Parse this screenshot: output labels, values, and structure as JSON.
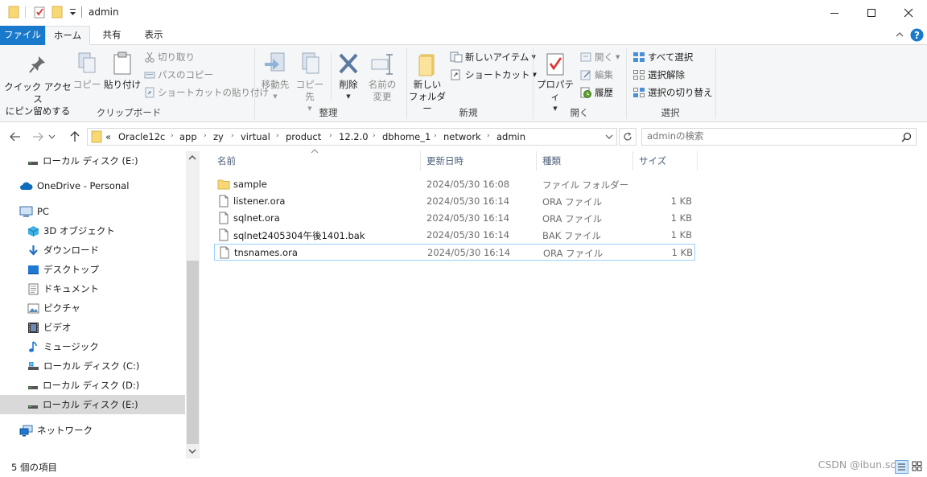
{
  "window": {
    "title": "admin",
    "minimize_glyph": "—",
    "maximize_glyph": "☐",
    "close_glyph": "✕"
  },
  "ribbon_tabs": [
    {
      "label": "ファイル"
    },
    {
      "label": "ホーム"
    },
    {
      "label": "共有"
    },
    {
      "label": "表示"
    }
  ],
  "ribbon": {
    "clipboard": {
      "pin_quick_access_line1": "クイック アクセス",
      "pin_quick_access_line2": "にピン留めする",
      "copy": "コピー",
      "paste": "貼り付け",
      "cut": "切り取り",
      "copy_path": "パスのコピー",
      "paste_shortcut": "ショートカットの貼り付け",
      "group_label": "クリップボード"
    },
    "organize": {
      "move_to": "移動先",
      "copy_to": "コピー先",
      "delete": "削除",
      "rename_line1": "名前の",
      "rename_line2": "変更",
      "group_label": "整理"
    },
    "new": {
      "new_folder_line1": "新しい",
      "new_folder_line2": "フォルダー",
      "new_item": "新しいアイテム",
      "shortcut": "ショートカット",
      "group_label": "新規"
    },
    "open": {
      "properties": "プロパティ",
      "open": "開く",
      "edit": "編集",
      "history": "履歴",
      "group_label": "開く"
    },
    "select": {
      "select_all": "すべて選択",
      "select_none": "選択解除",
      "invert_selection": "選択の切り替え",
      "group_label": "選択"
    }
  },
  "address": {
    "overflow": "«",
    "crumbs": [
      "Oracle12c",
      "app",
      "zy",
      "virtual",
      "product",
      "12.2.0",
      "dbhome_1",
      "network",
      "admin"
    ]
  },
  "search": {
    "placeholder": "adminの検索"
  },
  "nav_pane": [
    {
      "label": "ローカル ディスク (E:)",
      "icon": "drive-icon",
      "level": 1
    },
    {
      "label": "OneDrive - Personal",
      "icon": "onedrive-cloud-icon",
      "level": 0
    },
    {
      "label": "PC",
      "icon": "pc-icon",
      "level": 0
    },
    {
      "label": "3D オブジェクト",
      "icon": "3d-objects-icon",
      "level": 1
    },
    {
      "label": "ダウンロード",
      "icon": "download-arrow-icon",
      "level": 1
    },
    {
      "label": "デスクトップ",
      "icon": "desktop-icon",
      "level": 1
    },
    {
      "label": "ドキュメント",
      "icon": "documents-icon",
      "level": 1
    },
    {
      "label": "ピクチャ",
      "icon": "pictures-icon",
      "level": 1
    },
    {
      "label": "ビデオ",
      "icon": "videos-icon",
      "level": 1
    },
    {
      "label": "ミュージック",
      "icon": "music-note-icon",
      "level": 1
    },
    {
      "label": "ローカル ディスク (C:)",
      "icon": "windows-drive-icon",
      "level": 1
    },
    {
      "label": "ローカル ディスク (D:)",
      "icon": "drive-icon",
      "level": 1
    },
    {
      "label": "ローカル ディスク (E:)",
      "icon": "drive-icon",
      "level": 1,
      "selected": true
    },
    {
      "label": "ネットワーク",
      "icon": "network-icon",
      "level": 0
    }
  ],
  "file_list": {
    "columns": [
      "名前",
      "更新日時",
      "種類",
      "サイズ"
    ],
    "rows": [
      {
        "name": "sample",
        "date": "2024/05/30 16:08",
        "type": "ファイル フォルダー",
        "size": "",
        "icon": "folder-icon"
      },
      {
        "name": "listener.ora",
        "date": "2024/05/30 16:14",
        "type": "ORA ファイル",
        "size": "1 KB",
        "icon": "file-icon"
      },
      {
        "name": "sqlnet.ora",
        "date": "2024/05/30 16:14",
        "type": "ORA ファイル",
        "size": "1 KB",
        "icon": "file-icon"
      },
      {
        "name": "sqlnet2405304午後1401.bak",
        "date": "2024/05/30 16:14",
        "type": "BAK ファイル",
        "size": "1 KB",
        "icon": "file-icon"
      },
      {
        "name": "tnsnames.ora",
        "date": "2024/05/30 16:14",
        "type": "ORA ファイル",
        "size": "1 KB",
        "icon": "file-icon",
        "selected": true
      }
    ]
  },
  "status": {
    "item_count": "5 個の項目",
    "watermark": "CSDN @ibun.song"
  },
  "colors": {
    "file_tab": "#1979ca",
    "selection_border": "#99d1ff",
    "nav_selected": "#d9d9d9",
    "folder": "#f8d775",
    "help": "#1979ca"
  }
}
